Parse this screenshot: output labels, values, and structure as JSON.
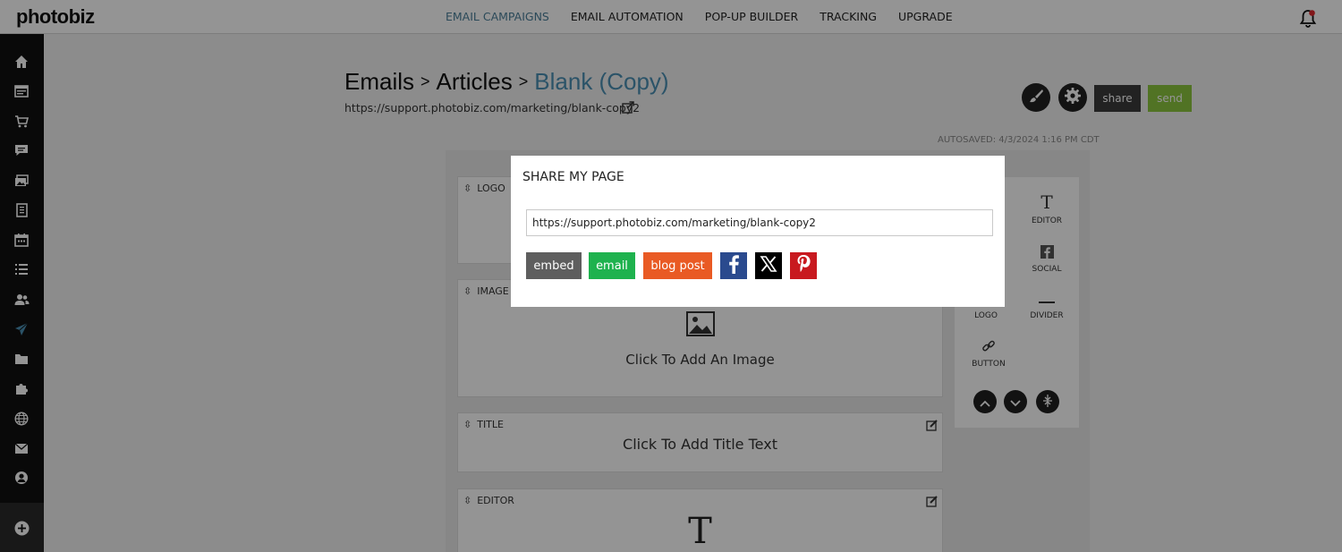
{
  "app": {
    "logo": "photobiz"
  },
  "topnav": {
    "items": [
      {
        "label": "EMAIL CAMPAIGNS",
        "active": true
      },
      {
        "label": "EMAIL AUTOMATION"
      },
      {
        "label": "POP-UP BUILDER"
      },
      {
        "label": "TRACKING"
      },
      {
        "label": "UPGRADE"
      }
    ]
  },
  "sidebar": {
    "icons": [
      "home-icon",
      "browser-icon",
      "cart-icon",
      "chat-icon",
      "gallery-icon",
      "document-icon",
      "calendar-icon",
      "list-icon",
      "users-icon",
      "send-icon",
      "folder-icon",
      "puzzle-icon",
      "globe-icon",
      "mail-icon",
      "account-icon"
    ],
    "add_icon": "plus-circle-icon"
  },
  "breadcrumb": {
    "part1": "Emails",
    "sep1": ">",
    "part2": "Articles",
    "sep2": ">",
    "current": "Blank (Copy)"
  },
  "page_url": "https://support.photobiz.com/marketing/blank-copy2",
  "toolbar": {
    "share_label": "share",
    "send_label": "send"
  },
  "autosaved": "AUTOSAVED: 4/3/2024 1:16 PM CDT",
  "blocks": {
    "logo": {
      "label": "LOGO"
    },
    "image": {
      "label": "IMAGE",
      "text": "Click To Add An Image"
    },
    "title": {
      "label": "TITLE",
      "text": "Click To Add Title Text"
    },
    "editor": {
      "label": "EDITOR",
      "glyph": "T"
    }
  },
  "widgets": {
    "editor": "EDITOR",
    "social": "SOCIAL",
    "logo": "LOGO",
    "divider": "DIVIDER",
    "button": "BUTTON"
  },
  "modal": {
    "title": "SHARE MY PAGE",
    "url": "https://support.photobiz.com/marketing/blank-copy2",
    "buttons": {
      "embed": "embed",
      "email": "email",
      "blog_post": "blog post"
    },
    "colors": {
      "embed": "#5e5e5e",
      "email": "#1eb24e",
      "blog_post": "#e95a24",
      "facebook": "#2a4a8e",
      "x": "#000000",
      "pinterest": "#c8191f",
      "send": "#8cc63f",
      "accent": "#4a90b4"
    }
  }
}
